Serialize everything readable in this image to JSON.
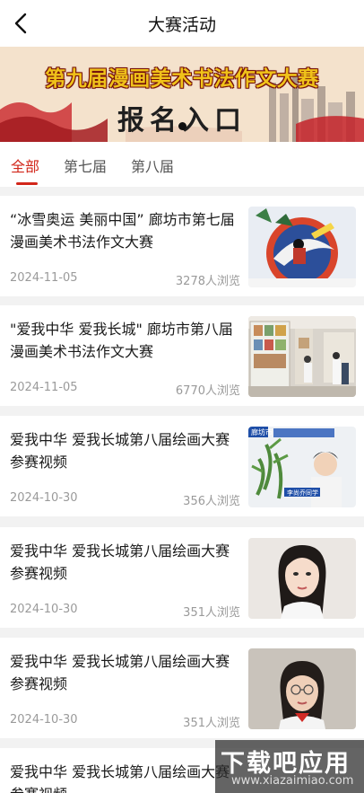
{
  "header": {
    "title": "大赛活动",
    "back_icon": "chevron-left-icon"
  },
  "banner": {
    "title": "第九届漫画美术书法作文大赛",
    "subtitle": "报名入口"
  },
  "tabs": [
    {
      "label": "全部",
      "active": true
    },
    {
      "label": "第七届",
      "active": false
    },
    {
      "label": "第八届",
      "active": false
    }
  ],
  "articles": [
    {
      "title": "“冰雪奥运 美丽中国” 廊坊市第七届漫画美术书法作文大赛",
      "date": "2024-11-05",
      "views": "3278人浏览",
      "thumb": "winter-olympics-painting"
    },
    {
      "title": "\"爱我中华 爱我长城\" 廊坊市第八届漫画美术书法作文大赛",
      "date": "2024-11-05",
      "views": "6770人浏览",
      "thumb": "exhibition-hall-photo"
    },
    {
      "title": "爱我中华 爱我长城第八届绘画大赛参赛视频",
      "date": "2024-10-30",
      "views": "356人浏览",
      "thumb": "boy-video-frame",
      "thumb_caption": "廊坊市",
      "thumb_name": "李尚乔同学"
    },
    {
      "title": "爱我中华 爱我长城第八届绘画大赛参赛视频",
      "date": "2024-10-30",
      "views": "351人浏览",
      "thumb": "girl-video-frame"
    },
    {
      "title": "爱我中华 爱我长城第八届绘画大赛参赛视频",
      "date": "2024-10-30",
      "views": "351人浏览",
      "thumb": "girl-glasses-video-frame"
    },
    {
      "title": "爱我中华 爱我长城第八届绘画大赛参赛视频",
      "date": "",
      "views": "",
      "thumb": ""
    }
  ],
  "watermark": {
    "main": "下载吧应用",
    "url": "www.xiazaimiao.com"
  },
  "colors": {
    "accent": "#d2261a",
    "banner_title": "#f0c21a"
  }
}
